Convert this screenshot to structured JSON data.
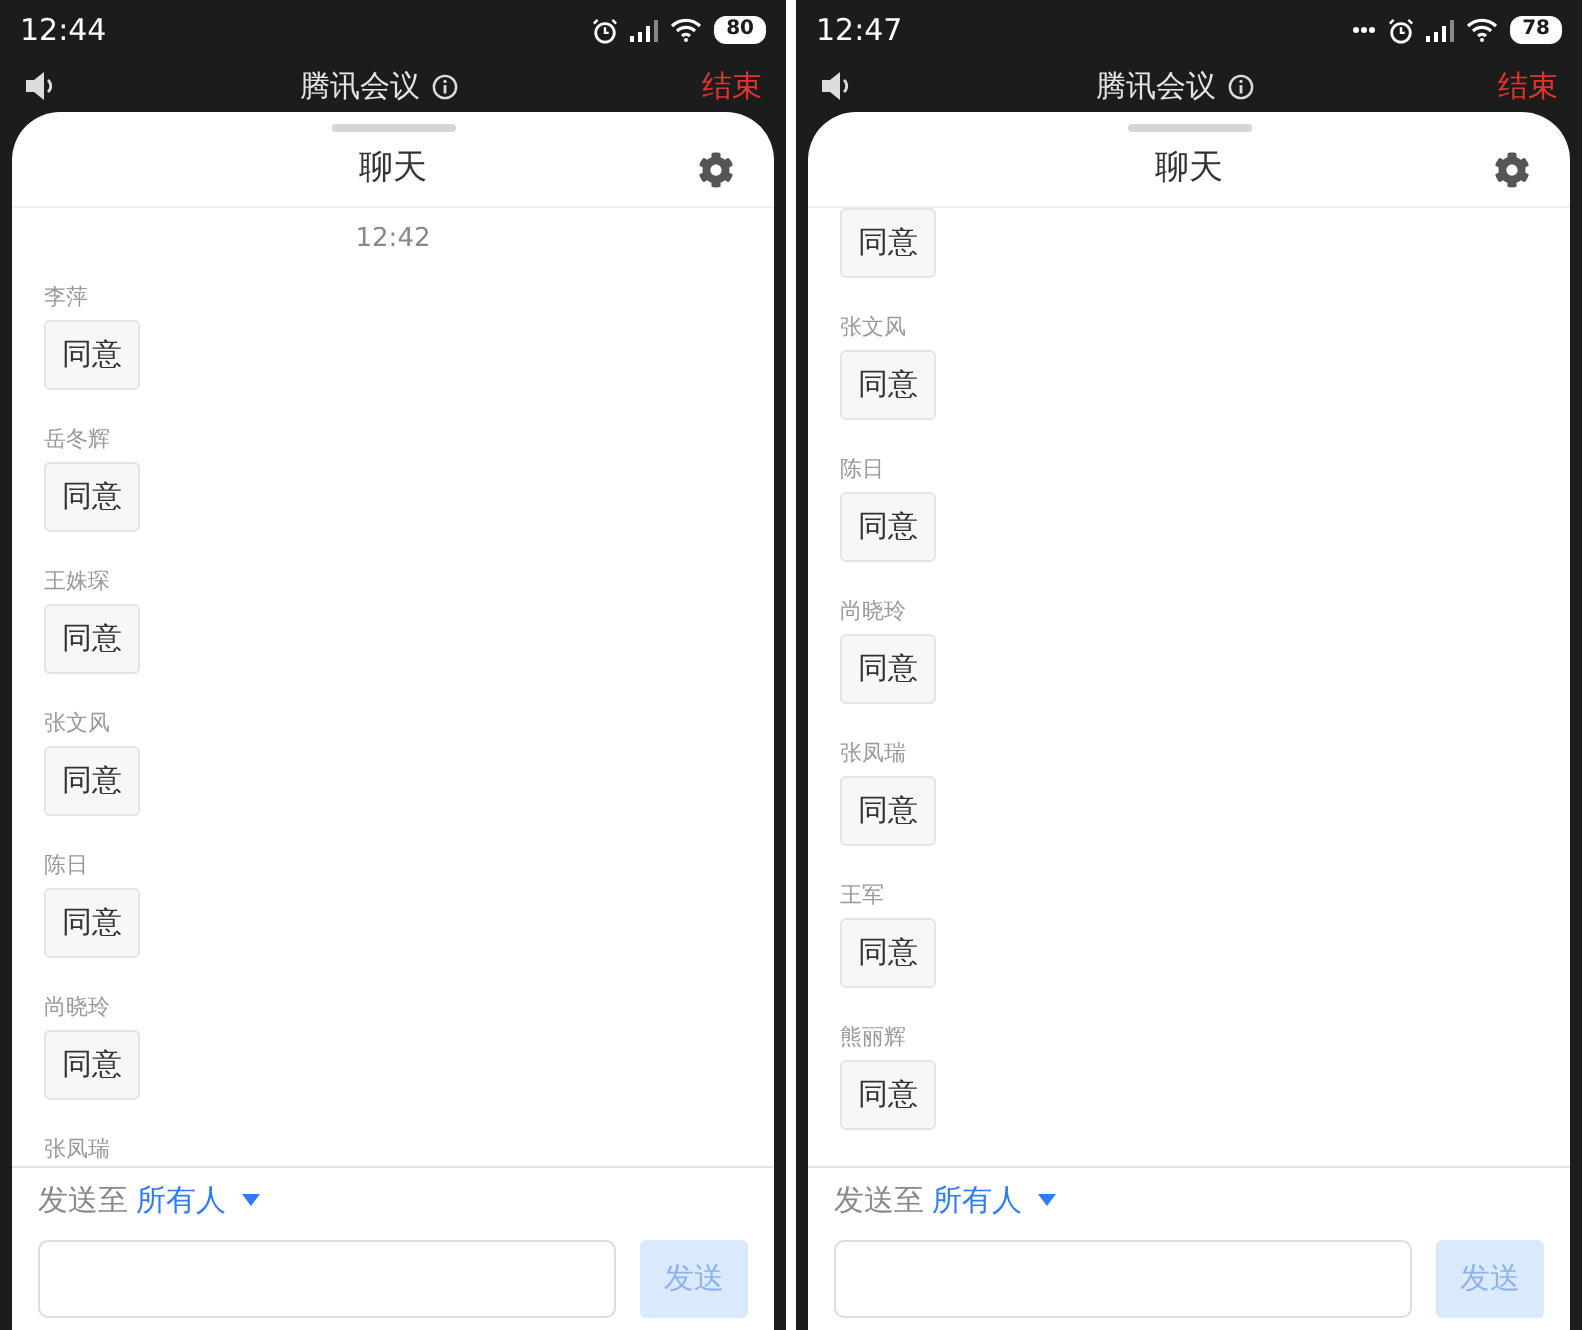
{
  "screens": [
    {
      "status_bar": {
        "time": "12:44",
        "notification_dots": false,
        "battery": "80"
      },
      "header": {
        "title": "腾讯会议",
        "end_button": "结束"
      },
      "chat": {
        "title": "聊天",
        "timestamp": "12:42",
        "messages": [
          {
            "sender": "李萍",
            "text": "同意"
          },
          {
            "sender": "岳冬辉",
            "text": "同意"
          },
          {
            "sender": "王姝琛",
            "text": "同意"
          },
          {
            "sender": "张文风",
            "text": "同意"
          },
          {
            "sender": "陈日",
            "text": "同意"
          },
          {
            "sender": "尚晓玲",
            "text": "同意"
          },
          {
            "sender": "张凤瑞"
          }
        ]
      },
      "footer": {
        "send_to_label": "发送至",
        "recipient": "所有人",
        "send_button": {
          "label": "发送",
          "disabled": true
        }
      }
    },
    {
      "status_bar": {
        "time": "12:47",
        "notification_dots": true,
        "battery": "78"
      },
      "header": {
        "title": "腾讯会议",
        "end_button": "结束"
      },
      "chat": {
        "title": "聊天",
        "messages": [
          {
            "text": "同意"
          },
          {
            "sender": "张文风",
            "text": "同意"
          },
          {
            "sender": "陈日",
            "text": "同意"
          },
          {
            "sender": "尚晓玲",
            "text": "同意"
          },
          {
            "sender": "张凤瑞",
            "text": "同意"
          },
          {
            "sender": "王军",
            "text": "同意"
          },
          {
            "sender": "熊丽辉",
            "text": "同意"
          }
        ]
      },
      "footer": {
        "send_to_label": "发送至",
        "recipient": "所有人",
        "send_button": {
          "label": "发送",
          "disabled": true
        }
      }
    }
  ]
}
